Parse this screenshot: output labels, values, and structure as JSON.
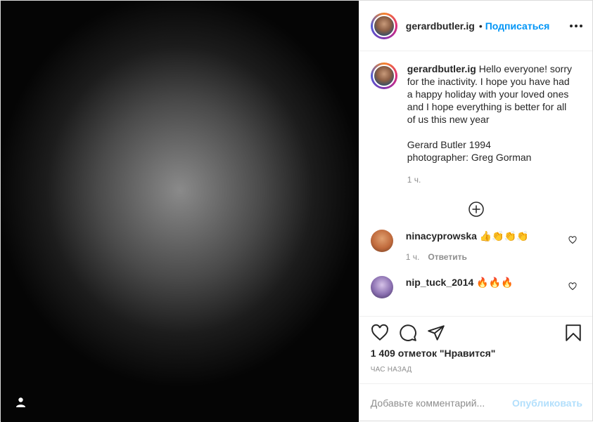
{
  "post": {
    "username": "gerardbutler.ig",
    "dot": "•",
    "follow_label": "Подписаться",
    "caption_text": "Hello everyone! sorry for the inactivity. I hope you have had a happy holiday with your loved ones and I hope everything is better for all of us this new year\n\nGerard Butler 1994\nphotographer: Greg Gorman",
    "caption_time": "1 ч.",
    "likes": "1 409 отметок \"Нравится\"",
    "posted_ago": "час назад"
  },
  "comments": [
    {
      "username": "ninacyprowska",
      "text": "👍👏👏👏",
      "time": "1 ч.",
      "reply": "Ответить",
      "avatar_color": "#c06a3c"
    },
    {
      "username": "nip_tuck_2014",
      "text": "🔥🔥🔥",
      "avatar_color": "#8a6fb0"
    }
  ],
  "add_comment": {
    "placeholder": "Добавьте комментарий...",
    "publish": "Опубликовать"
  },
  "colors": {
    "accent": "#0095f6",
    "publish_disabled": "#b2dffc",
    "muted": "#8e8e8e"
  },
  "icons": [
    "user-tag-icon",
    "more-options-icon",
    "load-more-plus-icon",
    "heart-icon",
    "comment-icon",
    "share-icon",
    "bookmark-icon"
  ]
}
